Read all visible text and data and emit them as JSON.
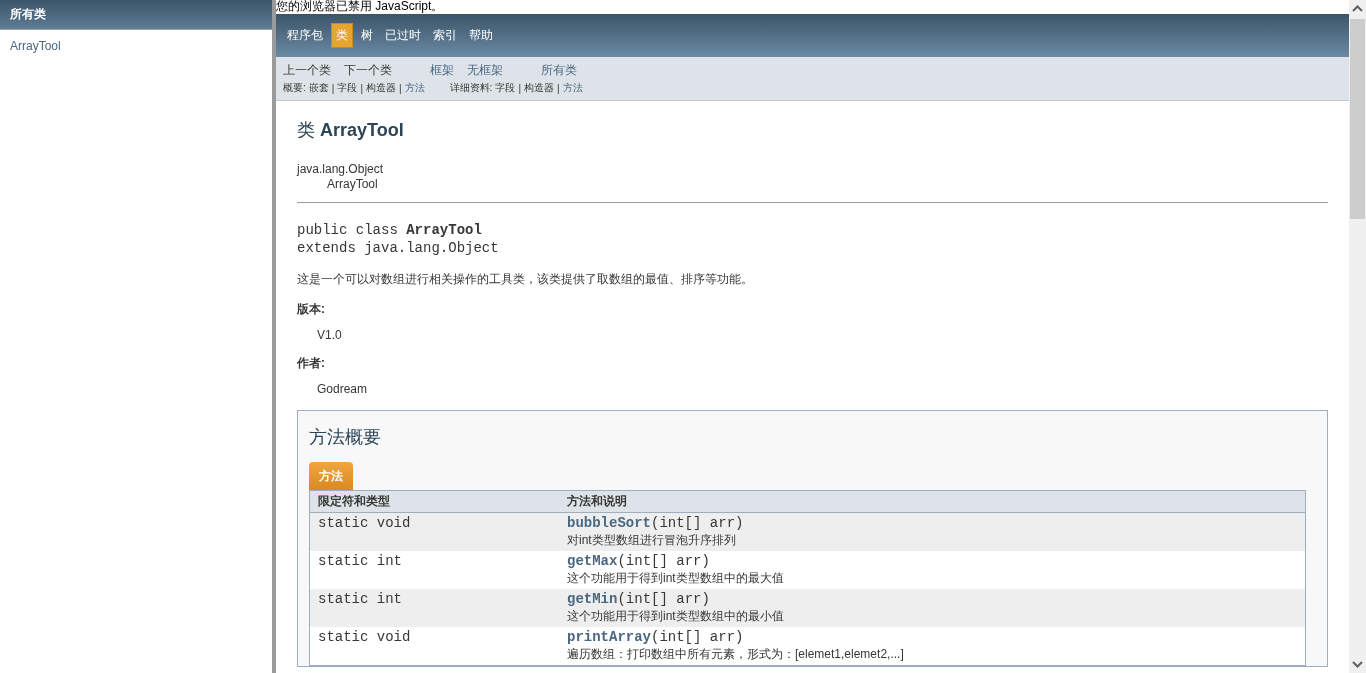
{
  "left_frame": {
    "header": "所有类",
    "classes": [
      "ArrayTool"
    ]
  },
  "noscript_notice": "您的浏览器已禁用 JavaScript。",
  "top_nav": {
    "items": [
      {
        "label": "程序包",
        "selected": false
      },
      {
        "label": "类",
        "selected": true
      },
      {
        "label": "树",
        "selected": false
      },
      {
        "label": "已过时",
        "selected": false
      },
      {
        "label": "索引",
        "selected": false
      },
      {
        "label": "帮助",
        "selected": false
      }
    ]
  },
  "sub_nav": {
    "row_1": [
      {
        "label": "上一个类",
        "link": false
      },
      {
        "label": "下一个类",
        "link": false
      },
      {
        "label": "框架",
        "link": true
      },
      {
        "label": "无框架",
        "link": true
      },
      {
        "label": "所有类",
        "link": true
      }
    ],
    "separator": "|",
    "summary": {
      "label": "概要:",
      "items": [
        {
          "label": "嵌套",
          "link": false
        },
        {
          "label": "字段",
          "link": false
        },
        {
          "label": "构造器",
          "link": false
        },
        {
          "label": "方法",
          "link": true
        }
      ]
    },
    "detail": {
      "label": "详细资料:",
      "items": [
        {
          "label": "字段",
          "link": false
        },
        {
          "label": "构造器",
          "link": false
        },
        {
          "label": "方法",
          "link": true
        }
      ]
    }
  },
  "class_doc": {
    "title": "类 **ArrayTool**",
    "inheritance": [
      "java.lang.Object",
      "ArrayTool"
    ],
    "signature": [
      "public class **ArrayTool**",
      "extends java.lang.Object"
    ],
    "description": "这是一个可以对数组进行相关操作的工具类，该类提供了取数组的最值、排序等功能。",
    "tags": [
      {
        "label": "版本:",
        "value": "V1.0"
      },
      {
        "label": "作者:",
        "value": "Godream"
      }
    ]
  },
  "method_summary": {
    "title": "方法概要",
    "tab": "方法",
    "columns": [
      "限定符和类型",
      "方法和说明"
    ],
    "rows": [
      {
        "modifier": "static void",
        "name": "bubbleSort",
        "params": "(int[] arr)",
        "description": "对int类型数组进行冒泡升序排列"
      },
      {
        "modifier": "static int",
        "name": "getMax",
        "params": "(int[] arr)",
        "description": "这个功能用于得到int类型数组中的最大值"
      },
      {
        "modifier": "static int",
        "name": "getMin",
        "params": "(int[] arr)",
        "description": "这个功能用于得到int类型数组中的最小值"
      },
      {
        "modifier": "static void",
        "name": "printArray",
        "params": "(int[] arr)",
        "description": "遍历数组：打印数组中所有元素，形式为：[elemet1,elemet2,...]"
      }
    ]
  }
}
